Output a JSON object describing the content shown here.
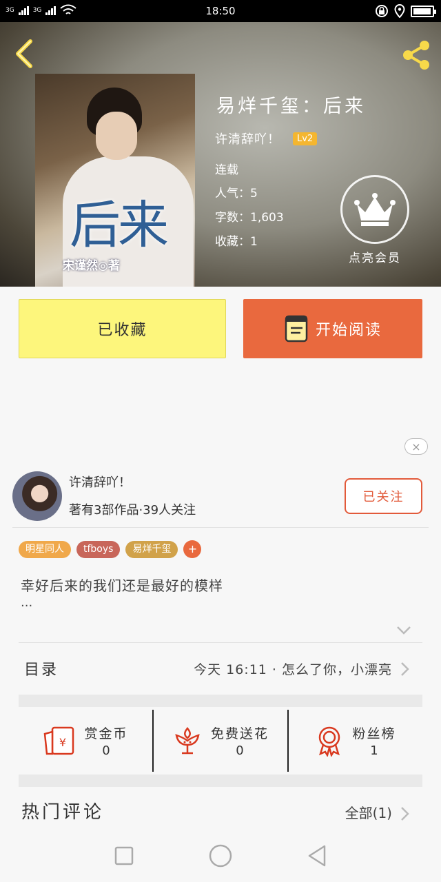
{
  "status_bar": {
    "net1": "3G",
    "net2": "3G",
    "time": "18:50",
    "battery_level": 0.95
  },
  "header": {
    "book_title": "易烊千玺：后来",
    "author": "许清辞吖！",
    "level": "Lv2",
    "status": "连载",
    "popularity": "人气：5",
    "word_count": "字数：1,603",
    "favorites": "收藏：1",
    "vip_label": "点亮会员",
    "cover_title": "后来",
    "cover_author": "宋谨然◎著",
    "icons": {
      "back": "chevron-left-icon",
      "share": "share-icon",
      "vip": "crown-icon"
    }
  },
  "actions": {
    "collected_label": "已收藏",
    "read_label": "开始阅读",
    "read_icon": "book-icon",
    "read_color": "#e9693e",
    "collected_color": "#fdf67c"
  },
  "ad_close": "×",
  "author_card": {
    "name": "许清辞吖！",
    "stats": "著有3部作品·39人关注",
    "follow_label": "已关注"
  },
  "tags": [
    {
      "label": "明星同人",
      "color": "#f0a84a"
    },
    {
      "label": "tfboys",
      "color": "#c8665a"
    },
    {
      "label": "易烊千玺",
      "color": "#d1a24a"
    }
  ],
  "tag_add": "+",
  "intro": {
    "text": "幸好后来的我们还是最好的模样",
    "ellipsis": "..."
  },
  "toc": {
    "label": "目录",
    "latest": "今天 16:11 · 怎么了你，小漂亮"
  },
  "stats": [
    {
      "label": "赏金币",
      "value": "0",
      "icon": "red-envelope-icon"
    },
    {
      "label": "免费送花",
      "value": "0",
      "icon": "flower-icon"
    },
    {
      "label": "粉丝榜",
      "value": "1",
      "icon": "ribbon-badge-icon"
    }
  ],
  "hot_comments": {
    "title": "热门评论",
    "all_label": "全部(1)"
  },
  "nav": {
    "icons": [
      "recents-icon",
      "home-icon",
      "back-icon"
    ]
  }
}
